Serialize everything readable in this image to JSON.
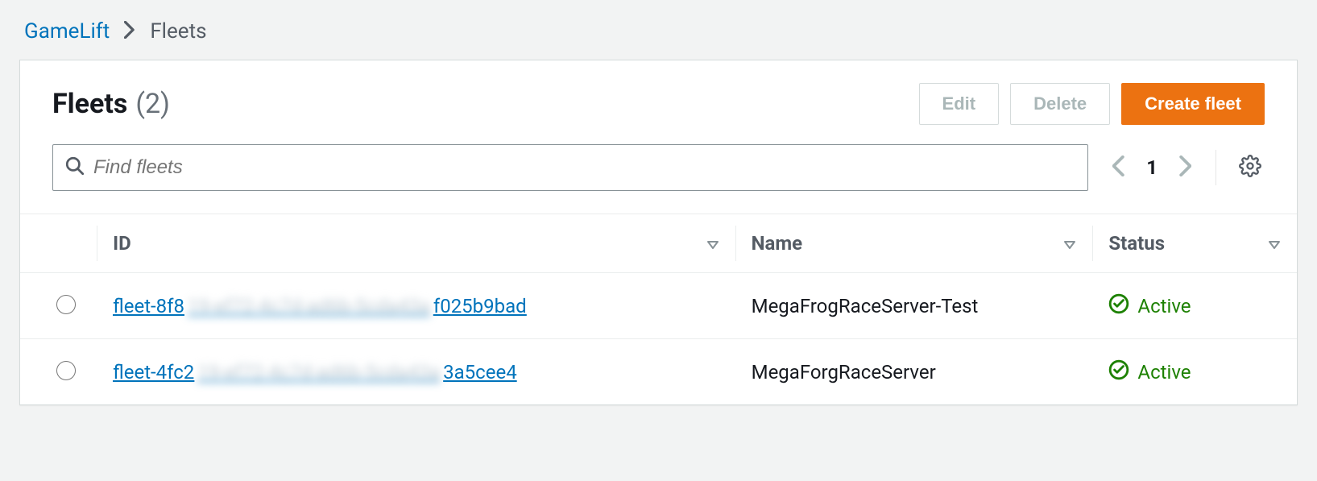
{
  "breadcrumb": {
    "root": "GameLift",
    "current": "Fleets"
  },
  "header": {
    "title": "Fleets",
    "count": "(2)",
    "edit_label": "Edit",
    "delete_label": "Delete",
    "create_label": "Create fleet"
  },
  "search": {
    "placeholder": "Find fleets"
  },
  "pager": {
    "page": "1"
  },
  "columns": {
    "id": "ID",
    "name": "Name",
    "status": "Status"
  },
  "rows": [
    {
      "id_prefix": "fleet-8f8",
      "id_mid": "19-ef72-4c7d-ad6b-5cda43a",
      "id_suffix": "f025b9bad",
      "name": "MegaFrogRaceServer-Test",
      "status": "Active"
    },
    {
      "id_prefix": "fleet-4fc2",
      "id_mid": "19-ef72-4c7d-ad6b-5cda43a",
      "id_suffix": "3a5cee4",
      "name": "MegaForgRaceServer",
      "status": "Active"
    }
  ]
}
